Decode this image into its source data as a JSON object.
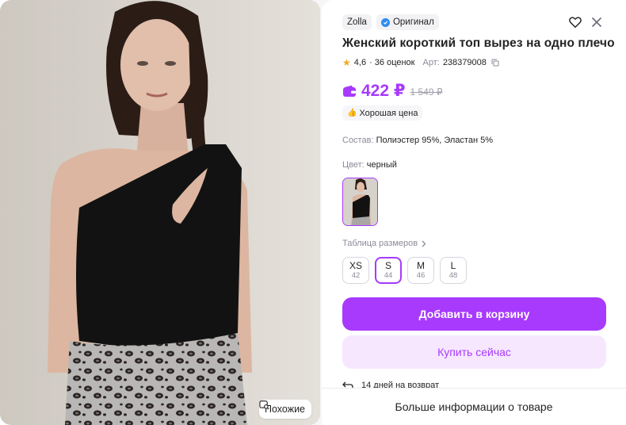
{
  "photo": {
    "similar_label": "Похожие"
  },
  "product": {
    "brand": "Zolla",
    "original_label": "Оригинал",
    "title": "Женский короткий топ вырез на одно плечо",
    "rating": "4,6",
    "reviews": "· 36 оценок",
    "article_label": "Арт:",
    "article": "238379008",
    "price": "422 ₽",
    "old_price": "1 549 ₽",
    "good_price_label": "Хорошая цена",
    "composition_label": "Состав:",
    "composition": "Полиэстер 95%, Эластан 5%",
    "color_label": "Цвет:",
    "color": "черный",
    "size_table_label": "Таблица размеров",
    "sizes": [
      {
        "name": "XS",
        "ru": "42"
      },
      {
        "name": "S",
        "ru": "44"
      },
      {
        "name": "M",
        "ru": "46"
      },
      {
        "name": "L",
        "ru": "48"
      }
    ],
    "selected_size": "S"
  },
  "actions": {
    "add_to_cart": "Добавить в корзину",
    "buy_now": "Купить сейчас",
    "returns": "14 дней на возврат",
    "more_info": "Больше информации о товаре"
  },
  "colors": {
    "accent": "#a73afd",
    "accent_light": "#f6e7fe",
    "star": "#f5a623",
    "verified": "#2d8cf0"
  },
  "icons": [
    "image-search-icon",
    "verified-icon",
    "heart-icon",
    "close-icon",
    "star-icon",
    "copy-icon",
    "wallet-icon",
    "thumbs-up-icon",
    "chevron-right-icon",
    "return-arrow-icon"
  ]
}
